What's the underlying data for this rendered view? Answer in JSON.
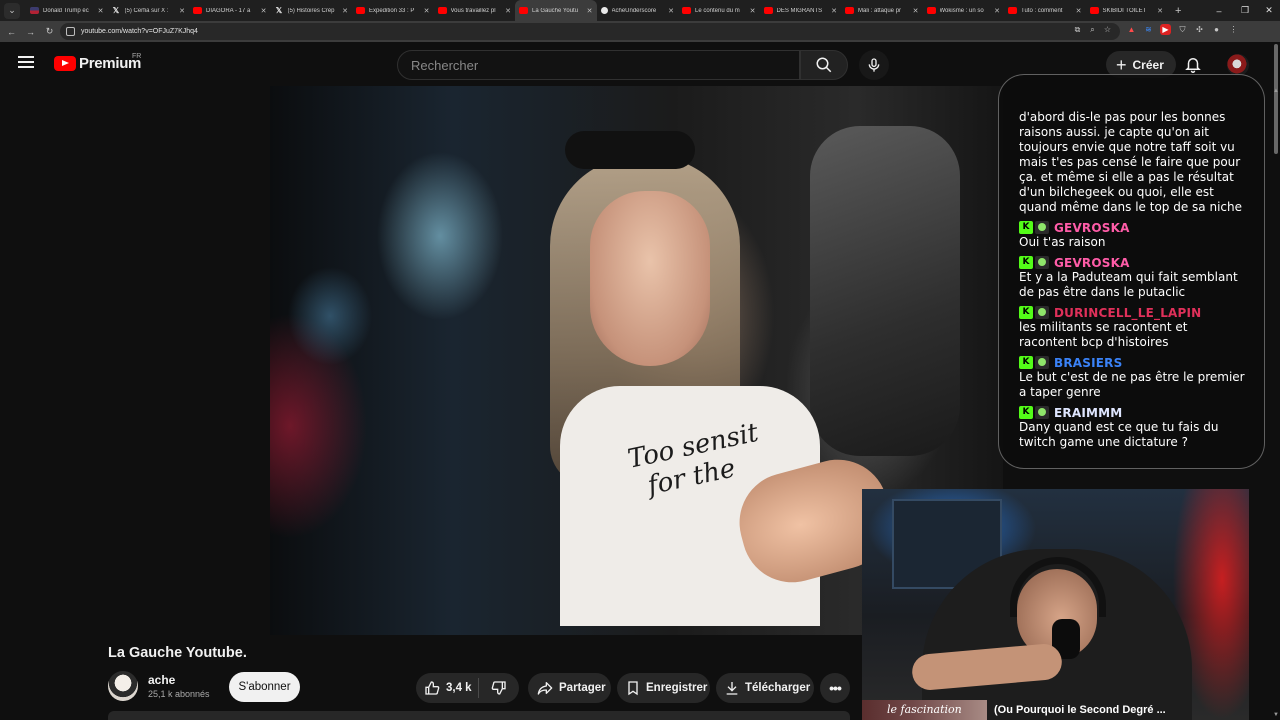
{
  "browser": {
    "tabs": [
      {
        "title": "Donald Trump éc",
        "icon": "us-flag-icon"
      },
      {
        "title": "(5) Cerfia sur X : ",
        "icon": "x-logo-icon"
      },
      {
        "title": "DIAGORA - 17 a",
        "icon": "youtube-icon"
      },
      {
        "title": "(5) Histoires Crép",
        "icon": "x-logo-icon"
      },
      {
        "title": "Expedition 33 : P",
        "icon": "youtube-icon"
      },
      {
        "title": "Vous travaillez pl",
        "icon": "youtube-icon"
      },
      {
        "title": "La Gauche Youtu",
        "icon": "youtube-icon",
        "active": true
      },
      {
        "title": "AcheUnderscore",
        "icon": "site-icon"
      },
      {
        "title": "Le contenu du m",
        "icon": "youtube-icon"
      },
      {
        "title": "DES MIGRANTS",
        "icon": "youtube-icon"
      },
      {
        "title": "Mali : attaque pr",
        "icon": "youtube-icon"
      },
      {
        "title": "Wokisme : un so",
        "icon": "youtube-icon"
      },
      {
        "title": "Tuto : comment",
        "icon": "youtube-icon"
      },
      {
        "title": "SKIBIDI TOILET",
        "icon": "youtube-icon"
      }
    ],
    "url": "youtube.com/watch?v=OFJuZ7KJhq4"
  },
  "header": {
    "logo_text": "Premium",
    "country": "FR",
    "search_placeholder": "Rechercher",
    "create_label": "Créer"
  },
  "chat": {
    "messages": [
      {
        "user": "",
        "color": "#ffffff",
        "text": "d'abord dis-le pas pour les bonnes raisons aussi. je capte qu'on ait toujours envie que notre taff soit vu mais t'es pas censé le faire que pour ça. et même si elle a pas le résultat d'un bilchegeek ou quoi, elle est quand même dans le top de sa niche"
      },
      {
        "user": "GEVROSKA",
        "color": "#ff5ca8",
        "text": "Oui t'as raison"
      },
      {
        "user": "GEVROSKA",
        "color": "#ff5ca8",
        "text": "Et y a la Paduteam qui fait semblant de pas être dans le putaclic"
      },
      {
        "user": "DURINCELL_LE_LAPIN",
        "color": "#e0305a",
        "text": "les militants se racontent et racontent bcp d'histoires"
      },
      {
        "user": "BRASIERS",
        "color": "#3a82f7",
        "text": "Le but c'est de ne pas être le premier a taper genre"
      },
      {
        "user": "ERAIMMM",
        "color": "#dfe6ff",
        "text": "Dany quand est ce que tu fais du twitch game une dictature ?"
      }
    ],
    "badge_letter": "K"
  },
  "player": {
    "shirt_text_line1": "Too sensit",
    "shirt_text_line2": "for the"
  },
  "webcam": {
    "thumb_text": "le fascination",
    "caption": "(Ou Pourquoi le Second Degré ..."
  },
  "video": {
    "title": "La Gauche Youtube.",
    "channel": "ache",
    "subscribers": "25,1 k abonnés",
    "subscribe_label": "S'abonner",
    "likes": "3,4 k",
    "share_label": "Partager",
    "save_label": "Enregistrer",
    "download_label": "Télécharger"
  }
}
